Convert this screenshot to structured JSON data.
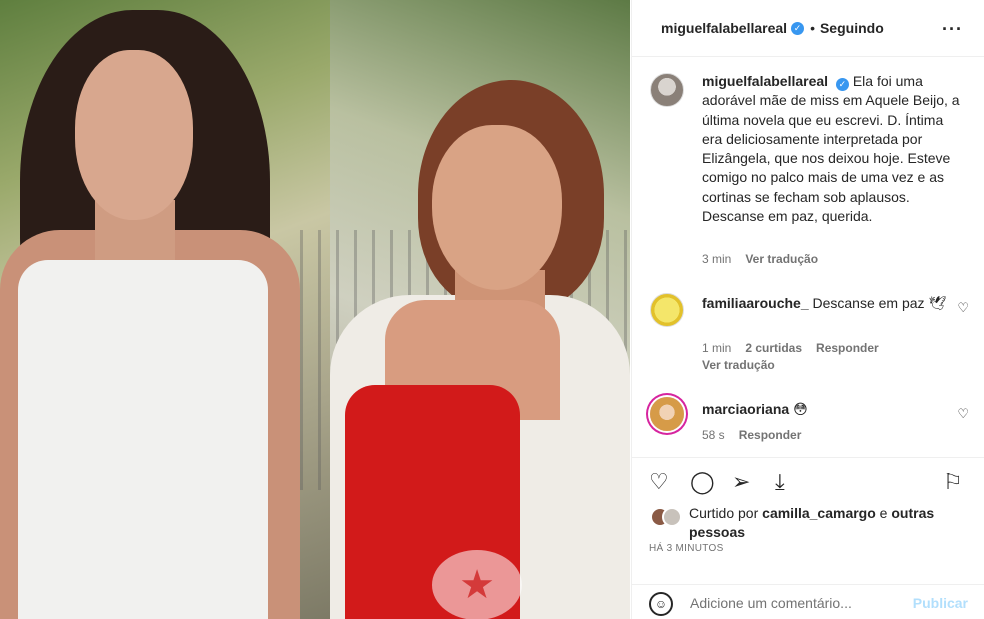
{
  "post": {
    "author": "miguelfalabellareal",
    "follow_status": "Seguindo",
    "watermark_glyph": "★",
    "caption": "Ela foi uma adorável mãe de miss em Aquele Beijo, a última novela que eu escrevi. D. Íntima era deliciosamente interpretada por Elizângela, que nos deixou hoje. Esteve comigo no palco mais de uma vez e as cortinas se fecham sob aplausos. Descanse em paz, querida.",
    "caption_time": "3 min",
    "see_translation": "Ver tradução"
  },
  "comments": [
    {
      "username": "familiaarouche_",
      "text": "Descanse em paz 🕊",
      "time": "1 min",
      "likes": "2 curtidas",
      "reply": "Responder",
      "translate": "Ver tradução"
    },
    {
      "username": "marciaoriana",
      "text": "😳",
      "time": "58 s",
      "reply": "Responder"
    }
  ],
  "likes_info": {
    "prefix": "Curtido por",
    "user": "camilla_camargo",
    "connector": "e",
    "others": "outras pessoas"
  },
  "timestamp": "HÁ 3 MINUTOS",
  "composer": {
    "placeholder": "Adicione um comentário...",
    "post_label": "Publicar"
  },
  "icons": {
    "verified": "verified-badge-icon",
    "more": "more-options-icon",
    "like": "heart-icon",
    "comment": "comment-icon",
    "share": "share-icon",
    "save": "bookmark-icon",
    "emoji": "emoji-icon"
  },
  "colors": {
    "verified": "#3897f0",
    "muted": "#737373",
    "post_button": "#b2dffc"
  }
}
